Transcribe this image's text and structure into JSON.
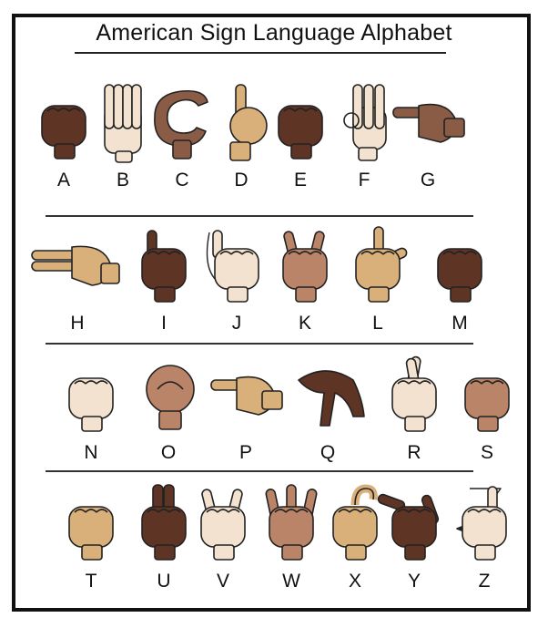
{
  "title": "American Sign Language Alphabet",
  "colors": {
    "border": "#111111",
    "skin_dark": "#5e3425",
    "skin_brown": "#8a5c46",
    "skin_tan": "#d9b07a",
    "skin_light": "#f2e2cf",
    "skin_medium": "#b98468",
    "outline": "#222222"
  },
  "rows": [
    {
      "signs": [
        {
          "letter": "A",
          "skin": "skin_dark",
          "icon": "fist-icon"
        },
        {
          "letter": "B",
          "skin": "skin_light",
          "icon": "flat-hand-icon"
        },
        {
          "letter": "C",
          "skin": "skin_brown",
          "icon": "curved-hand-icon"
        },
        {
          "letter": "D",
          "skin": "skin_tan",
          "icon": "index-up-icon"
        },
        {
          "letter": "E",
          "skin": "skin_dark",
          "icon": "fist-icon"
        },
        {
          "letter": "F",
          "skin": "skin_light",
          "icon": "ok-hand-icon"
        },
        {
          "letter": "G",
          "skin": "skin_brown",
          "icon": "point-side-icon"
        }
      ]
    },
    {
      "signs": [
        {
          "letter": "H",
          "skin": "skin_tan",
          "icon": "two-fingers-side-icon"
        },
        {
          "letter": "I",
          "skin": "skin_dark",
          "icon": "pinky-up-icon"
        },
        {
          "letter": "J",
          "skin": "skin_light",
          "icon": "pinky-trace-icon"
        },
        {
          "letter": "K",
          "skin": "skin_medium",
          "icon": "v-hand-icon"
        },
        {
          "letter": "L",
          "skin": "skin_tan",
          "icon": "l-hand-icon"
        },
        {
          "letter": "M",
          "skin": "skin_dark",
          "icon": "fist-icon"
        }
      ]
    },
    {
      "signs": [
        {
          "letter": "N",
          "skin": "skin_light",
          "icon": "fist-icon"
        },
        {
          "letter": "O",
          "skin": "skin_medium",
          "icon": "o-hand-icon"
        },
        {
          "letter": "P",
          "skin": "skin_tan",
          "icon": "point-side-icon"
        },
        {
          "letter": "Q",
          "skin": "skin_dark",
          "icon": "point-down-icon"
        },
        {
          "letter": "R",
          "skin": "skin_light",
          "icon": "crossed-fingers-icon"
        },
        {
          "letter": "S",
          "skin": "skin_medium",
          "icon": "fist-icon"
        }
      ]
    },
    {
      "signs": [
        {
          "letter": "T",
          "skin": "skin_tan",
          "icon": "fist-icon"
        },
        {
          "letter": "U",
          "skin": "skin_dark",
          "icon": "two-fingers-up-icon"
        },
        {
          "letter": "V",
          "skin": "skin_light",
          "icon": "v-hand-icon"
        },
        {
          "letter": "W",
          "skin": "skin_medium",
          "icon": "three-fingers-up-icon"
        },
        {
          "letter": "X",
          "skin": "skin_tan",
          "icon": "hook-finger-icon"
        },
        {
          "letter": "Y",
          "skin": "skin_dark",
          "icon": "y-hand-icon"
        },
        {
          "letter": "Z",
          "skin": "skin_light",
          "icon": "z-trace-icon"
        }
      ]
    }
  ]
}
